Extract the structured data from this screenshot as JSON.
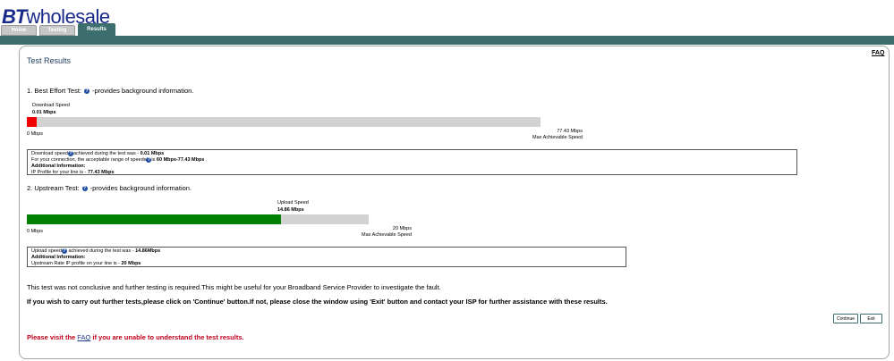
{
  "brand": {
    "bt": "BT",
    "name": "wholesale"
  },
  "tabs": [
    {
      "label": "Home",
      "active": false
    },
    {
      "label": "Testing",
      "active": false
    },
    {
      "label": "Results",
      "active": true
    }
  ],
  "colors": {
    "band": "#3d6e6e",
    "download_bar": "#ee0000",
    "upload_bar": "#008000",
    "track": "#d2d2d2",
    "warning": "#c0001a"
  },
  "faq_link": "FAQ",
  "panel_title": "Test Results",
  "best_effort": {
    "title_prefix": "1. Best Effort Test:",
    "title_suffix": "-provides background information.",
    "bar_label": "Download Speed",
    "bar_value": "0.01 Mbps",
    "min_label": "0 Mbps",
    "max_value": "77.43 Mbps",
    "max_label": "Max Achievable Speed",
    "fill_fraction": 0.0193,
    "info": {
      "line1_pre": "Download speed",
      "line1_mid": "achieved during the test was - ",
      "line1_value": "0.01 Mbps",
      "line2_pre": "For your connection, the acceptable range of speeds",
      "line2_mid": "is ",
      "line2_value": "60 Mbps-77.43 Mbps",
      "line2_post": " .",
      "line3": "Additional Information:",
      "line4_pre": "IP Profile for your line is - ",
      "line4_value": "77.43 Mbps"
    }
  },
  "upstream": {
    "title_prefix": "2. Upstream Test:",
    "title_suffix": "-provides background information.",
    "bar_label": "Upload Speed",
    "bar_value": "14.86 Mbps",
    "min_label": "0 Mbps",
    "max_value": "20 Mbps",
    "max_label": "Max Achievable Speed",
    "fill_fraction": 0.743,
    "info": {
      "line1_pre": "Upload speed",
      "line1_mid": " achieved during the test was - ",
      "line1_value": "14.86Mbps",
      "line2": "Additional Information:",
      "line3_pre": "Upstream Rate IP profile on your line is - ",
      "line3_value": "20 Mbps"
    }
  },
  "message1": "This test was not conclusive and further testing is required.This might be useful for your Broadband Service Provider to investigate the fault.",
  "message2": "If you wish to carry out further tests,please click on 'Continue' button.If not, please close the window using 'Exit' button and contact your ISP for further assistance with these results.",
  "buttons": {
    "continue": "Continue",
    "exit": "Exit"
  },
  "warning": {
    "pre": "Please visit the ",
    "link": "FAQ",
    "post": " if you are unable to understand the test results."
  }
}
